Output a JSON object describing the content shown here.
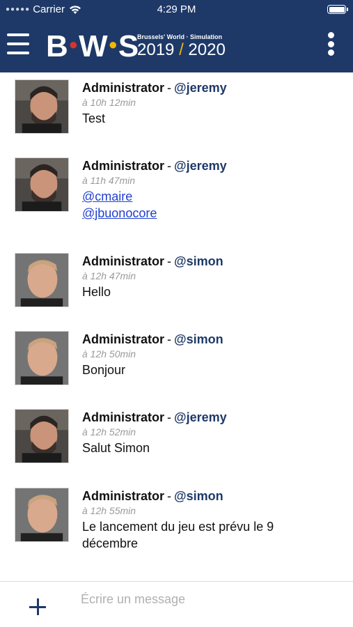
{
  "status_bar": {
    "carrier": "Carrier",
    "time": "4:29 PM"
  },
  "header": {
    "background": "#1e3968",
    "logo": {
      "letters": "BWS",
      "subtitle": "Brussels' World · Simulation",
      "year_start": "2019",
      "separator": "/",
      "year_end": "2020"
    }
  },
  "messages": [
    {
      "author": "Administrator",
      "separator": "-",
      "handle": "@jeremy",
      "time": "à 10h 12min",
      "text": "Test",
      "avatar": "avatar-jeremy"
    },
    {
      "author": "Administrator",
      "separator": "-",
      "handle": "@jeremy",
      "time": "à 11h 47min",
      "mentions": [
        "@cmaire",
        "@jbuonocore"
      ],
      "avatar": "avatar-jeremy"
    },
    {
      "author": "Administrator",
      "separator": "-",
      "handle": "@simon",
      "time": "à 12h 47min",
      "text": "Hello",
      "avatar": "avatar-simon"
    },
    {
      "author": "Administrator",
      "separator": "-",
      "handle": "@simon",
      "time": "à 12h 50min",
      "text": "Bonjour",
      "avatar": "avatar-simon"
    },
    {
      "author": "Administrator",
      "separator": "-",
      "handle": "@jeremy",
      "time": "à 12h 52min",
      "text": "Salut Simon",
      "avatar": "avatar-jeremy"
    },
    {
      "author": "Administrator",
      "separator": "-",
      "handle": "@simon",
      "time": "à 12h 55min",
      "text": "Le lancement du jeu est prévu le 9 décembre",
      "avatar": "avatar-simon"
    }
  ],
  "composer": {
    "placeholder": "Écrire un message"
  },
  "colors": {
    "accent": "#1e3968",
    "link": "#1f3fcf",
    "timestamp": "#9a9a9a",
    "logo_red": "#d9342b",
    "logo_yellow": "#f2b705"
  }
}
